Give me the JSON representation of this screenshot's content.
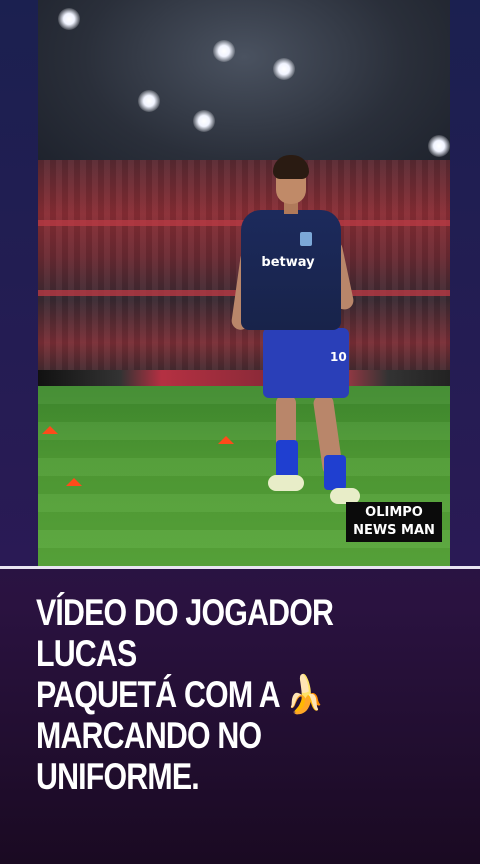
{
  "watermark": {
    "line1": "OLIMPO",
    "line2": "NEWS MAN"
  },
  "player": {
    "shirt_sponsor": "betway",
    "number": "10"
  },
  "caption": {
    "line1": "VÍDEO DO JOGADOR LUCAS",
    "line2_text": "PAQUETÁ COM A",
    "line2_emoji": "🍌",
    "line3": "MARCANDO NO UNIFORME."
  },
  "colors": {
    "background_top": "#1a1f4a",
    "background_bottom": "#1a0a22",
    "caption_text": "#ffffff",
    "pitch": "#4f9b34"
  }
}
